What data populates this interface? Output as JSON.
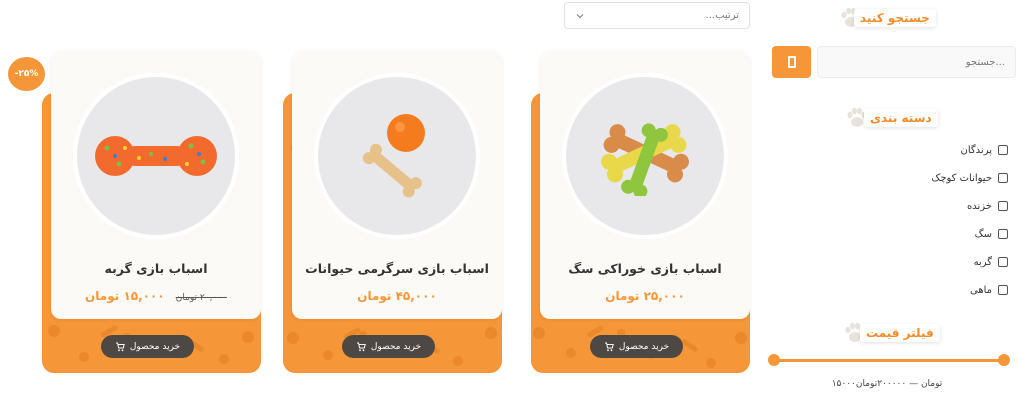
{
  "sort": {
    "placeholder": "ترتیب..."
  },
  "sidebar": {
    "search_heading": "جستجو کنید",
    "search_placeholder": "جستجو...",
    "category_heading": "دسته بندی",
    "categories": [
      {
        "label": "پرندگان",
        "checked": false
      },
      {
        "label": "حیوانات کوچک",
        "checked": false
      },
      {
        "label": "خزنده",
        "checked": false
      },
      {
        "label": "سگ",
        "checked": false
      },
      {
        "label": "گربه",
        "checked": false
      },
      {
        "label": "ماهی",
        "checked": false
      }
    ],
    "price_heading": "فیلتر قیمت",
    "price_range_text": "۱۵۰۰۰تومان — ۲۰۰۰۰۰تومان"
  },
  "products": [
    {
      "name": "اسباب بازی خوراکی سگ",
      "price": "۲۵,۰۰۰ تومان",
      "old_price": "",
      "buy_label": "خرید محصول",
      "image_icon": "dog-chew-bones-image"
    },
    {
      "name": "اسباب بازی سرگرمی حیوانات",
      "price": "۴۵,۰۰۰ تومان",
      "old_price": "",
      "buy_label": "خرید محصول",
      "image_icon": "ball-and-bone-image"
    },
    {
      "name": "اسباب بازی گربه",
      "price": "۱۵,۰۰۰ تومان",
      "old_price": "۲۰,۰۰۰ تومان",
      "buy_label": "خرید محصول",
      "image_icon": "rubber-dumbbell-image",
      "discount_badge": "-۲۵%"
    }
  ],
  "colors": {
    "accent": "#f59638",
    "dark_button": "#4e4845",
    "card_bg": "#fbfaf6"
  }
}
